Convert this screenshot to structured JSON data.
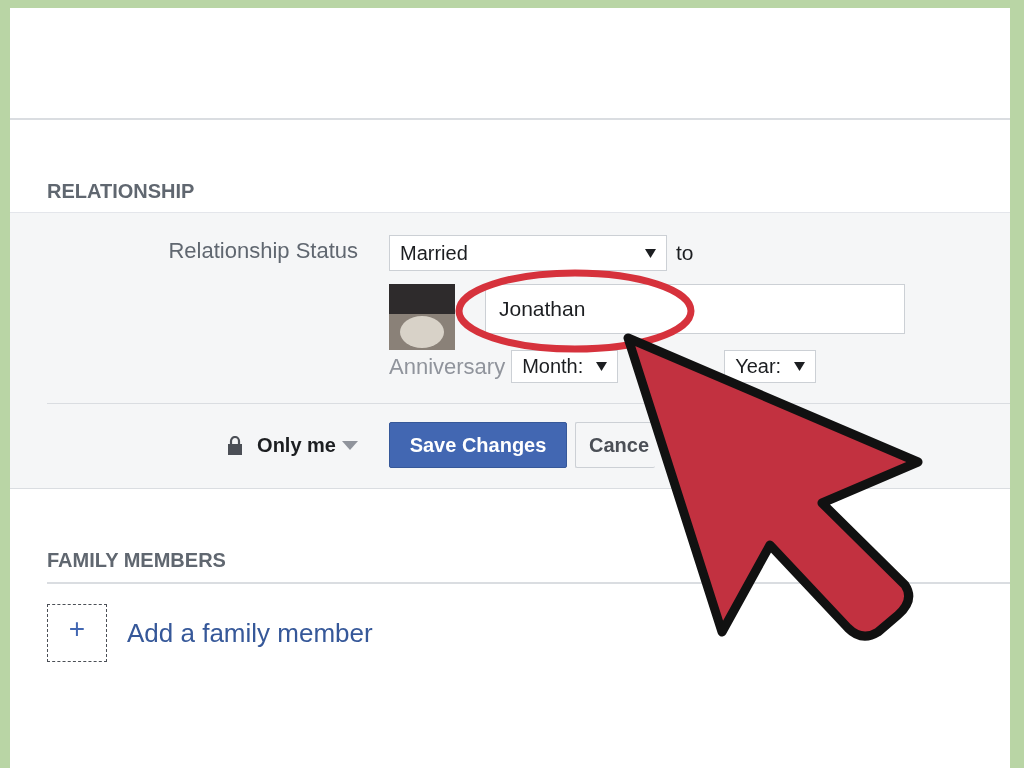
{
  "relationship": {
    "heading": "RELATIONSHIP",
    "status_label": "Relationship Status",
    "status_value": "Married",
    "to_label": "to",
    "partner_value": "Jonathan",
    "anniversary_label": "Anniversary",
    "month_value": "Month:",
    "year_value": "Year:",
    "privacy": "Only me",
    "save_button": "Save Changes",
    "cancel_button": "Cance"
  },
  "family": {
    "heading": "FAMILY MEMBERS",
    "add_icon": "+",
    "add_link": "Add a family member"
  }
}
